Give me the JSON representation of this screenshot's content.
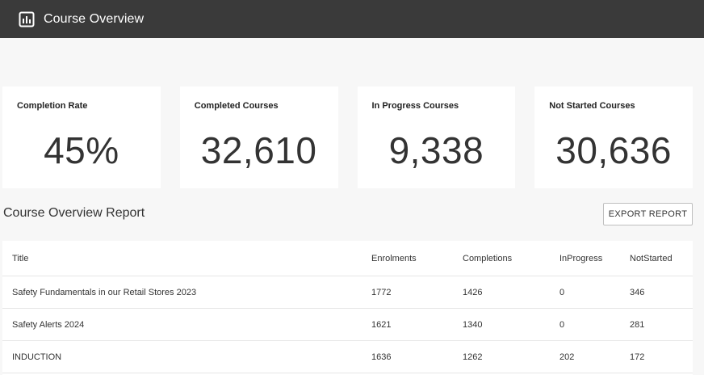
{
  "header": {
    "title": "Course Overview",
    "icon": "bar-chart-icon"
  },
  "stats": [
    {
      "label": "Completion Rate",
      "value": "45%"
    },
    {
      "label": "Completed Courses",
      "value": "32,610"
    },
    {
      "label": "In Progress Courses",
      "value": "9,338"
    },
    {
      "label": "Not Started Courses",
      "value": "30,636"
    }
  ],
  "report": {
    "title": "Course Overview Report",
    "export_label": "EXPORT REPORT"
  },
  "table": {
    "columns": [
      "Title",
      "Enrolments",
      "Completions",
      "InProgress",
      "NotStarted"
    ],
    "rows": [
      [
        "Safety Fundamentals in our Retail Stores 2023",
        "1772",
        "1426",
        "0",
        "346"
      ],
      [
        "Safety Alerts 2024",
        "1621",
        "1340",
        "0",
        "281"
      ],
      [
        "INDUCTION",
        "1636",
        "1262",
        "202",
        "172"
      ]
    ]
  },
  "colors": {
    "header_bg": "#3a3a3a",
    "page_bg": "#f7f7f7",
    "card_bg": "#ffffff"
  }
}
